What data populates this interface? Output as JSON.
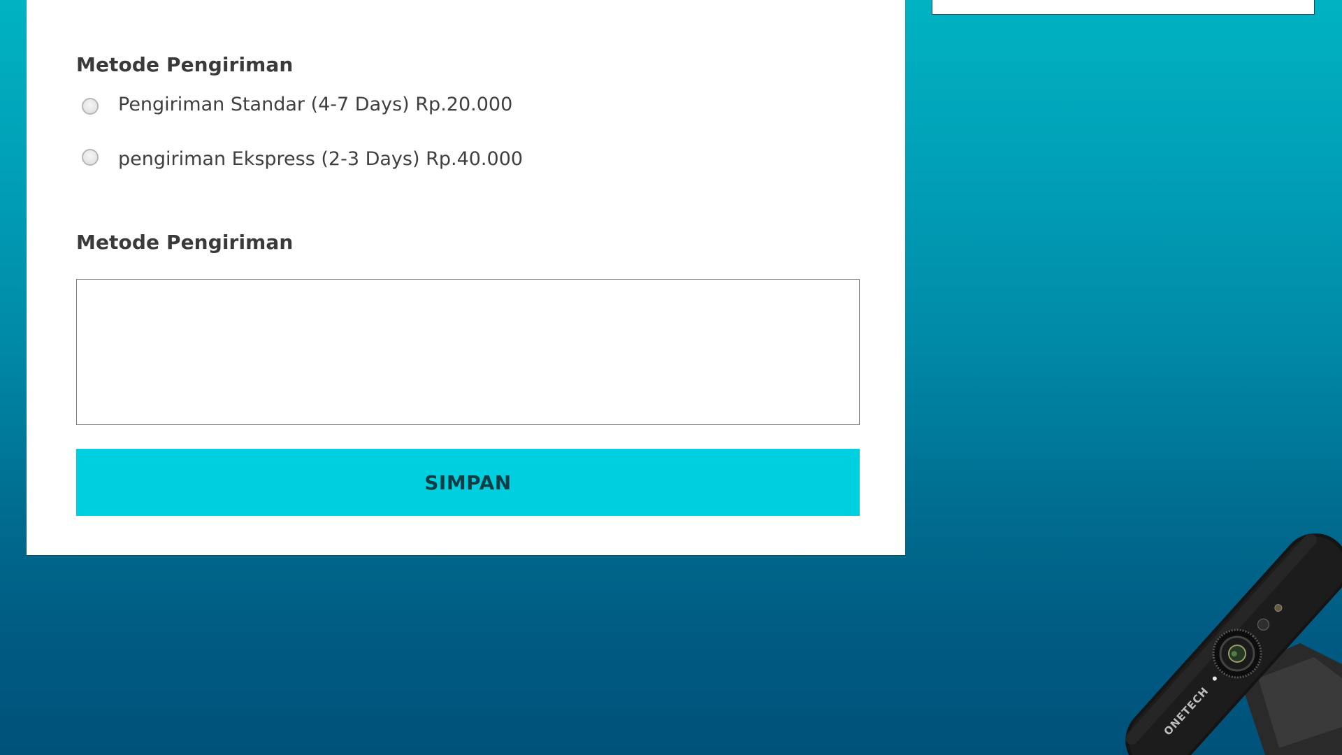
{
  "form": {
    "shipping_section_title": "Metode Pengiriman",
    "shipping_options": [
      {
        "label": "Pengiriman Standar (4-7 Days) Rp.20.000",
        "selected": false
      },
      {
        "label": "pengiriman Ekspress (2-3 Days) Rp.40.000",
        "selected": false
      }
    ],
    "notes_section_title": "Metode Pengiriman",
    "notes_value": "",
    "save_label": "SIMPAN"
  },
  "webcam_brand": "ONETECH",
  "colors": {
    "button": "#00cfe0",
    "background_top": "#00b3c2",
    "background_bottom": "#00527a"
  }
}
